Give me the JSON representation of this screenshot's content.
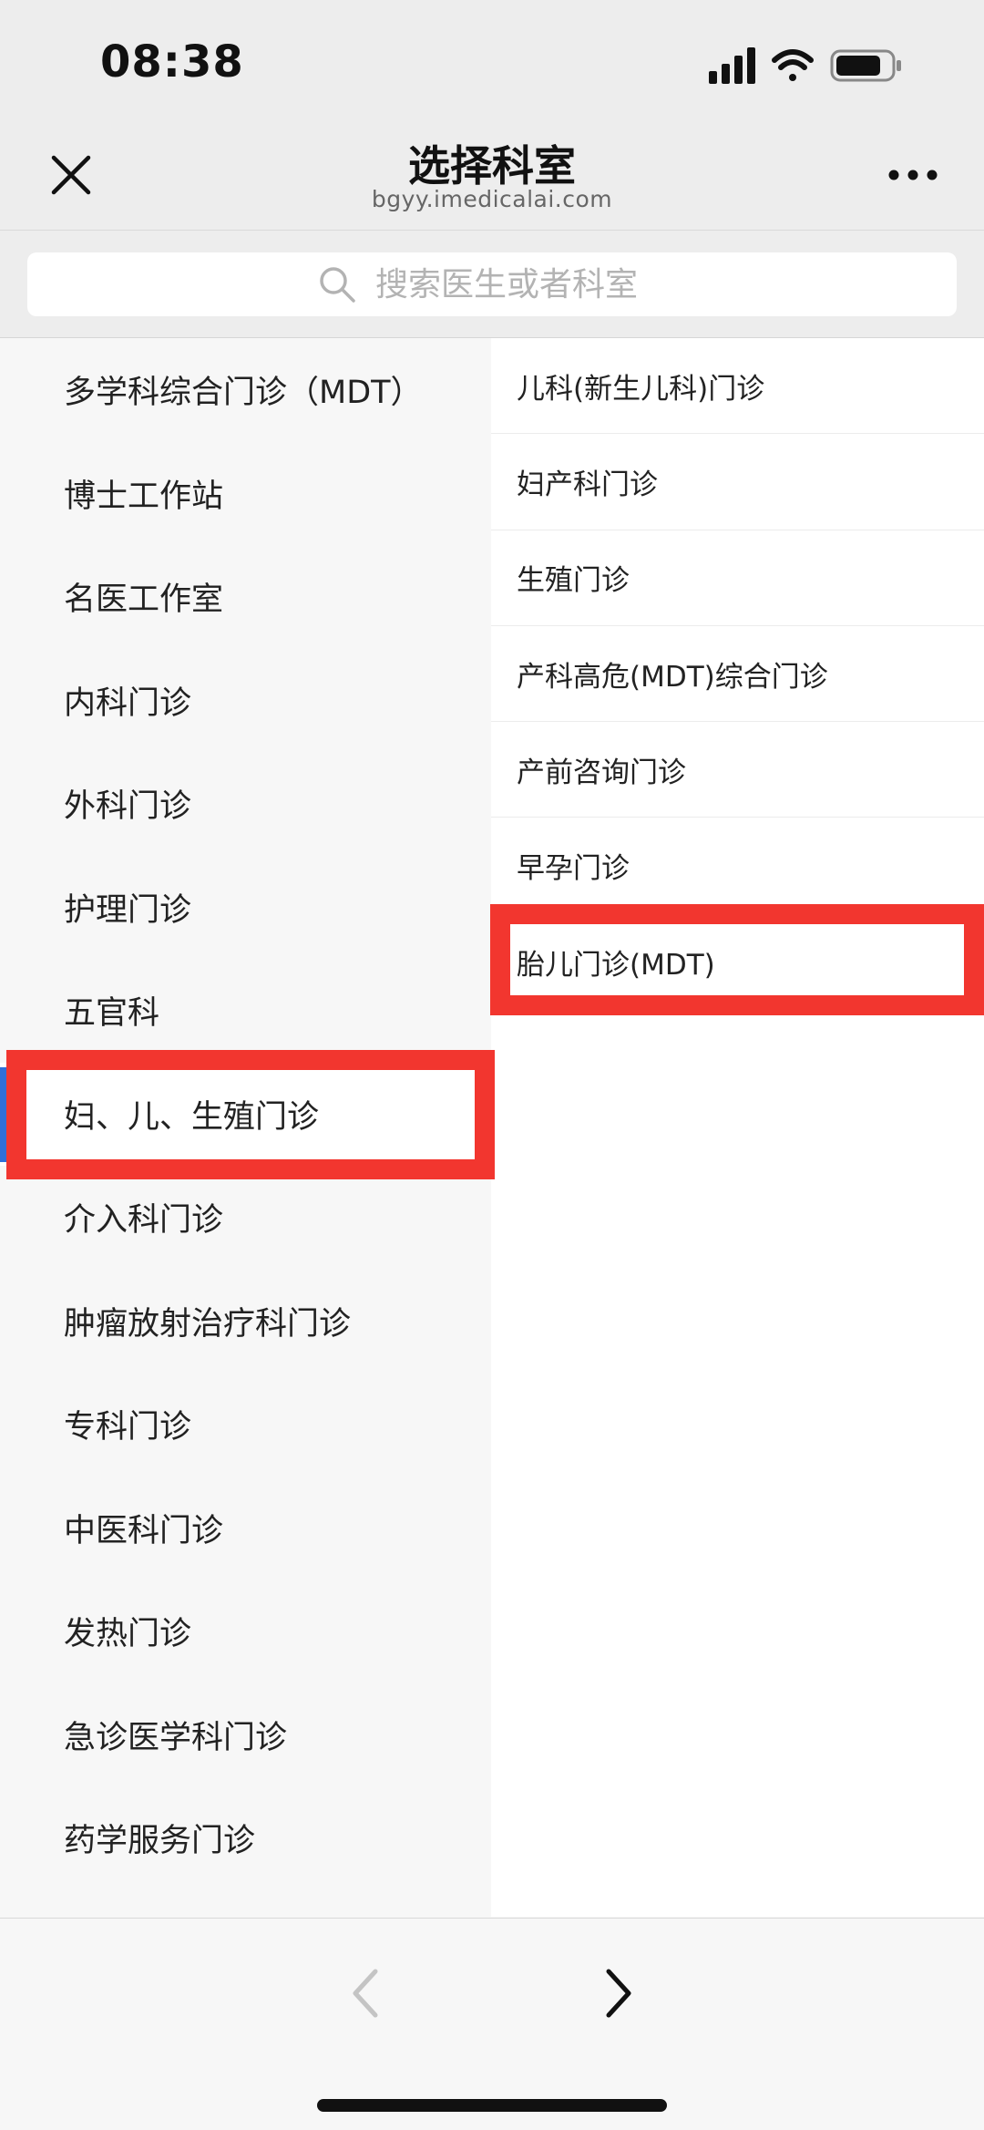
{
  "status_bar": {
    "time": "08:38",
    "icons": [
      "signal-icon",
      "wifi-icon",
      "battery-icon"
    ]
  },
  "header": {
    "title": "选择科室",
    "subtitle": "bgyy.imedicalai.com",
    "close_icon": "close-icon",
    "more_icon": "more-icon"
  },
  "search": {
    "placeholder": "搜索医生或者科室",
    "icon": "search-icon"
  },
  "departments": [
    {
      "label": "多学科综合门诊（MDT）"
    },
    {
      "label": "博士工作站"
    },
    {
      "label": "名医工作室"
    },
    {
      "label": "内科门诊"
    },
    {
      "label": "外科门诊"
    },
    {
      "label": "护理门诊"
    },
    {
      "label": "五官科"
    },
    {
      "label": "妇、儿、生殖门诊"
    },
    {
      "label": "介入科门诊"
    },
    {
      "label": "肿瘤放射治疗科门诊"
    },
    {
      "label": "专科门诊"
    },
    {
      "label": "中医科门诊"
    },
    {
      "label": "发热门诊"
    },
    {
      "label": "急诊医学科门诊"
    },
    {
      "label": "药学服务门诊"
    }
  ],
  "selected_department": "妇、儿、生殖门诊",
  "sub_departments": [
    {
      "label": "儿科(新生儿科)门诊"
    },
    {
      "label": "妇产科门诊"
    },
    {
      "label": "生殖门诊"
    },
    {
      "label": "产科高危(MDT)综合门诊"
    },
    {
      "label": "产前咨询门诊"
    },
    {
      "label": "早孕门诊"
    },
    {
      "label": "胎儿门诊(MDT)"
    }
  ],
  "highlighted_sub_department": "胎儿门诊(MDT)",
  "bottom_bar": {
    "back_icon": "chevron-left-icon",
    "forward_icon": "chevron-right-icon"
  },
  "colors": {
    "highlight_red": "#f2362f",
    "selected_indicator": "#2f6fd8",
    "header_bg": "#ededed",
    "list_bg": "#f7f7f7"
  }
}
